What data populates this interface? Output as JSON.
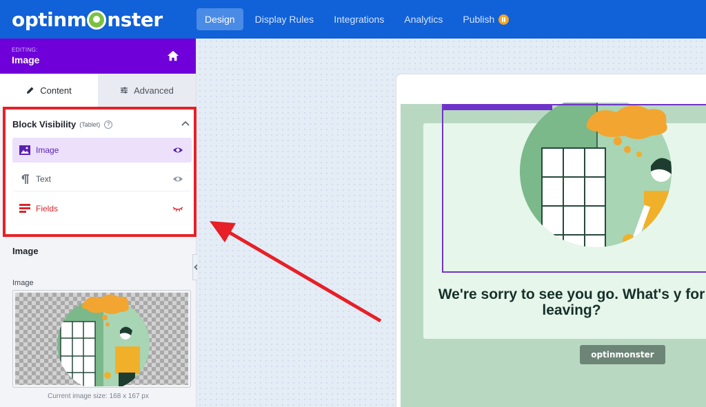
{
  "topbar": {
    "logo": "optinmonster",
    "nav": [
      "Design",
      "Display Rules",
      "Integrations",
      "Analytics",
      "Publish"
    ],
    "active": "Design"
  },
  "editing": {
    "kicker": "EDITING:",
    "title": "Image"
  },
  "tabs": {
    "content": "Content",
    "advanced": "Advanced"
  },
  "visibility": {
    "title": "Block Visibility",
    "device": "(Tablet)",
    "items": [
      {
        "label": "Image",
        "state": "visible-selected"
      },
      {
        "label": "Text",
        "state": "visible"
      },
      {
        "label": "Fields",
        "state": "hidden"
      }
    ]
  },
  "image_section": {
    "title": "Image",
    "label": "Image",
    "caption": "Current image size: 168 x 167 px"
  },
  "preview": {
    "headline": "We're sorry to see you go. What's y for leaving?",
    "brand": "optinmonster"
  },
  "colors": {
    "topbar": "#1161d8",
    "editing_header": "#6f00d9",
    "highlight": "#e62026",
    "popup_green": "#b9d8c2"
  }
}
